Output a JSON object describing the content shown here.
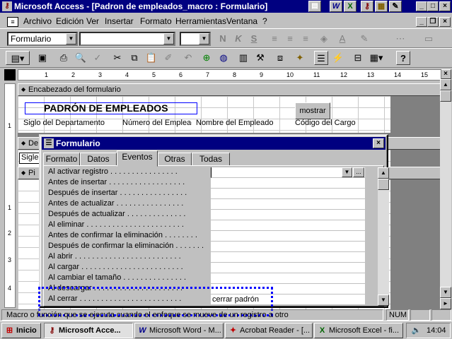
{
  "window": {
    "title": "Microsoft Access - [Padron de empleados_macro : Formulario]"
  },
  "menubar": {
    "items": [
      "Archivo",
      "Edición",
      "Ver",
      "Insertar",
      "Formato",
      "Herramientas",
      "Ventana",
      "?"
    ]
  },
  "format_toolbar": {
    "object_combo": "Formulario",
    "font_combo": "",
    "size_combo": "",
    "bold": "N",
    "italic": "K",
    "underline": "S"
  },
  "ruler": {
    "marks": [
      "1",
      "2",
      "3",
      "4",
      "5",
      "6",
      "7",
      "8",
      "9",
      "10",
      "11",
      "12",
      "13",
      "14",
      "15"
    ]
  },
  "design": {
    "header_section": "Encabezado del formulario",
    "detail_section": "De",
    "footer_section": "Pi",
    "title_label": "PADRÓN DE EMPLEADOS",
    "mostrar_button": "mostrar",
    "col_labels": [
      "Siglo del Departamento",
      "Número del Empleado",
      "Nombre del Empleado",
      "Código del Cargo"
    ],
    "detail_field": "Sigle"
  },
  "dialog": {
    "title": "Formulario",
    "tabs": [
      "Formato",
      "Datos",
      "Eventos",
      "Otras",
      "Todas"
    ],
    "active_tab": "Eventos",
    "properties": [
      {
        "name": "Al activar registro . . . . . . . . . . . . . . . .",
        "value": ""
      },
      {
        "name": "Antes de insertar . . . . . . . . . . . . . . . . . .",
        "value": ""
      },
      {
        "name": "Después de insertar . . . . . . . . . . . . . . . .",
        "value": ""
      },
      {
        "name": "Antes de actualizar . . . . . . . . . . . . . . . .",
        "value": ""
      },
      {
        "name": "Después de actualizar . . . . . . . . . . . . . .",
        "value": ""
      },
      {
        "name": "Al eliminar . . . . . . . . . . . . . . . . . . . . . . .",
        "value": ""
      },
      {
        "name": "Antes de confirmar la eliminación . . . . . . . .",
        "value": ""
      },
      {
        "name": "Después de confirmar la eliminación . . . . . . .",
        "value": ""
      },
      {
        "name": "Al abrir . . . . . . . . . . . . . . . . . . . . . . . . .",
        "value": ""
      },
      {
        "name": "Al cargar . . . . . . . . . . . . . . . . . . . . . . . .",
        "value": ""
      },
      {
        "name": "Al cambiar el tamaño . . . . . . . . . . . . . . .",
        "value": ""
      },
      {
        "name": "Al descargar . . . . . . . . . . . . . . . . . . . . .",
        "value": ""
      },
      {
        "name": "Al cerrar . . . . . . . . . . . . . . . . . . . . . . . .",
        "value": "cerrar padrón"
      }
    ]
  },
  "statusbar": {
    "message": "Macro o función que se ejecuta cuando el enfoque se mueve de un registro a otro",
    "num": "NUM"
  },
  "taskbar": {
    "start": "Inicio",
    "tasks": [
      "Microsoft Acce...",
      "Microsoft Word - M...",
      "Acrobat Reader - [...",
      "Microsoft Excel - fi..."
    ],
    "clock": "14:04"
  },
  "colors": {
    "titlebar": "#000080",
    "highlight": "#0000ff"
  }
}
